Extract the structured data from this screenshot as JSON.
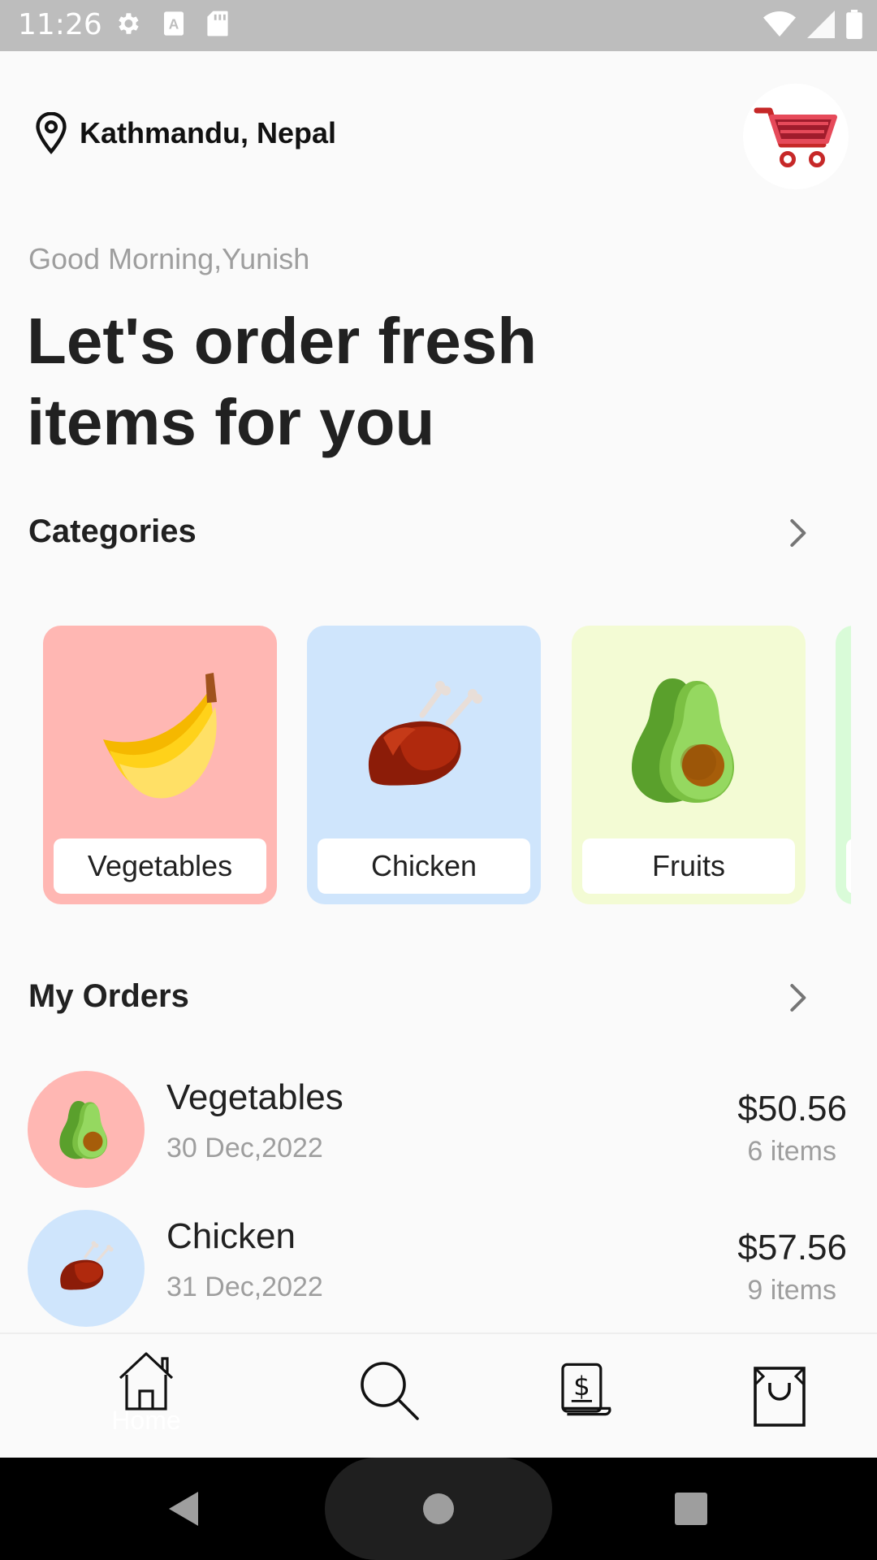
{
  "status_bar": {
    "time": "11:26"
  },
  "header": {
    "location": "Kathmandu, Nepal",
    "greeting": "Good Morning,Yunish",
    "headline": "Let's order fresh items for you"
  },
  "categories": {
    "title": "Categories",
    "items": [
      {
        "label": "Vegetables",
        "bg": "#ffb7b3",
        "icon": "banana-icon"
      },
      {
        "label": "Chicken",
        "bg": "#cfe5fc",
        "icon": "chicken-icon"
      },
      {
        "label": "Fruits",
        "bg": "#f3fbd4",
        "icon": "avocado-icon"
      }
    ]
  },
  "orders": {
    "title": "My Orders",
    "items": [
      {
        "name": "Vegetables",
        "date": "30 Dec,2022",
        "price": "$50.56",
        "count": "6 items",
        "bg": "#ffb7b3",
        "icon": "avocado-icon"
      },
      {
        "name": "Chicken",
        "date": "31 Dec,2022",
        "price": "$57.56",
        "count": "9 items",
        "bg": "#cfe5fc",
        "icon": "chicken-icon"
      }
    ]
  },
  "bottom_nav": {
    "items": [
      {
        "label": "Home",
        "icon": "home-icon"
      },
      {
        "label": "",
        "icon": "search-icon"
      },
      {
        "label": "",
        "icon": "receipt-icon"
      },
      {
        "label": "",
        "icon": "shopping-bag-icon"
      }
    ]
  },
  "colors": {
    "accent": "#e53935",
    "veg_bg": "#ffb7b3",
    "chicken_bg": "#cfe5fc",
    "fruit_bg": "#f3fbd4",
    "next_bg": "#d9fbd8"
  }
}
